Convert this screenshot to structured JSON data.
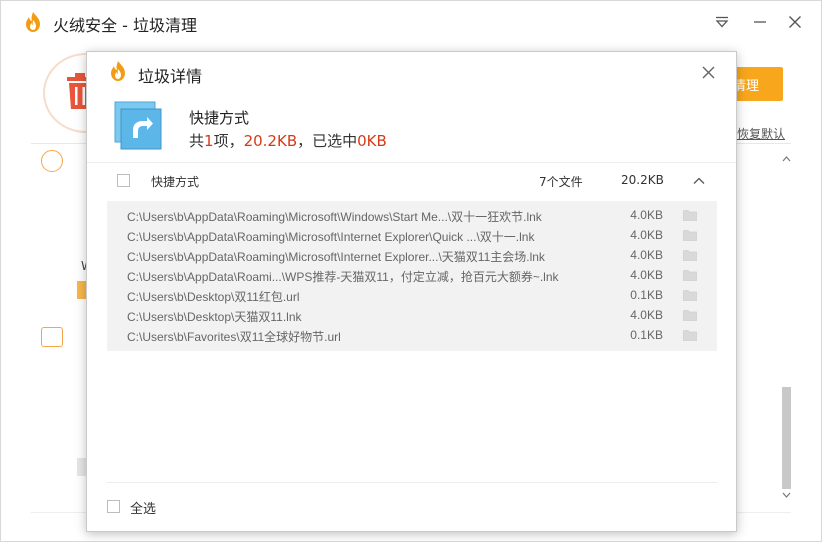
{
  "app": {
    "title": "火绒安全 - 垃圾清理",
    "clean_button": "清理",
    "restore_default": "恢复默认",
    "left_label_w": "W",
    "brand_color": "#f8a71c"
  },
  "dialog": {
    "title": "垃圾详情",
    "category": {
      "name": "快捷方式",
      "summary_prefix": "共",
      "count": "1",
      "summary_mid1": "项，",
      "total_size": "20.2KB",
      "summary_mid2": "，已选中",
      "selected_size": "0KB",
      "highlight_color": "#d63a16"
    },
    "group": {
      "label": "快捷方式",
      "file_count": "7个文件",
      "size": "20.2KB",
      "checked": false,
      "expanded": true
    },
    "files": [
      {
        "path": "C:\\Users\\b\\AppData\\Roaming\\Microsoft\\Windows\\Start Me...\\双十一狂欢节.lnk",
        "size": "4.0KB"
      },
      {
        "path": "C:\\Users\\b\\AppData\\Roaming\\Microsoft\\Internet Explorer\\Quick ...\\双十一.lnk",
        "size": "4.0KB"
      },
      {
        "path": "C:\\Users\\b\\AppData\\Roaming\\Microsoft\\Internet Explorer...\\天猫双11主会场.lnk",
        "size": "4.0KB"
      },
      {
        "path": "C:\\Users\\b\\AppData\\Roami...\\WPS推荐-天猫双11，付定立减，抢百元大额券~.lnk",
        "size": "4.0KB"
      },
      {
        "path": "C:\\Users\\b\\Desktop\\双11红包.url",
        "size": "0.1KB"
      },
      {
        "path": "C:\\Users\\b\\Desktop\\天猫双11.lnk",
        "size": "4.0KB"
      },
      {
        "path": "C:\\Users\\b\\Favorites\\双11全球好物节.url",
        "size": "0.1KB"
      }
    ],
    "select_all_label": "全选"
  }
}
